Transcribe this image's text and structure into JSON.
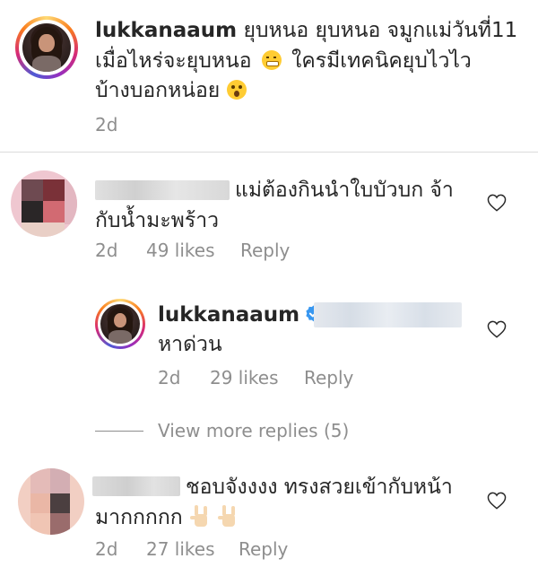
{
  "main_comment": {
    "username": "lukkanaaum",
    "text_line1": "ยุบหนอ ยุบหนอ จมูกแม่วันที่11",
    "text_line2": "เมื่อไหร่จะยุบหนอ",
    "text_line2b": "ใครมีเทคนิคยุบไวไว",
    "text_line3": "บ้างบอกหน่อย",
    "time": "2d"
  },
  "comments": [
    {
      "text_line1": "แม่ต้องกินนำใบบัวบก จ้า",
      "text_line2": "กับน้ำมะพร้าว",
      "time": "2d",
      "likes": "49 likes",
      "reply_label": "Reply"
    },
    {
      "username": "lukkanaaum",
      "verified": true,
      "text": "หาด่วน",
      "time": "2d",
      "likes": "29 likes",
      "reply_label": "Reply"
    },
    {
      "text_line1": "ชอบจังงงง ทรงสวยเข้ากับหน้า",
      "text_line2": "มากกกกก",
      "time": "2d",
      "likes": "27 likes",
      "reply_label": "Reply"
    }
  ],
  "view_more_replies": "View more replies (5)",
  "icons": {
    "heart": "heart-outline-icon",
    "verified": "verified-badge-icon",
    "emoji_1": "grimacing-face-emoji",
    "emoji_2": "surprised-face-emoji",
    "emoji_3": "rock-hand-emoji"
  },
  "colors": {
    "username": "#262626",
    "meta": "#8e8e8e",
    "verified": "#3897f0",
    "divider": "#dbdbdb"
  }
}
